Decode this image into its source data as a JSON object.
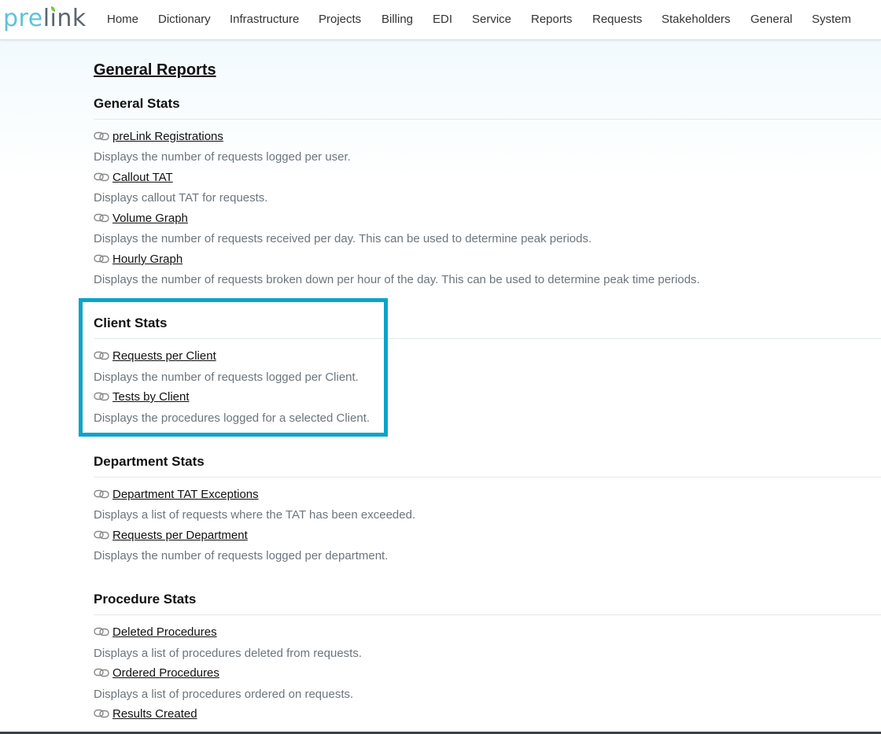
{
  "logo": {
    "part1": "pre",
    "part2": "link",
    "leaf_color": "#7ac943",
    "accent": "#5ec2d6"
  },
  "nav": {
    "items": [
      "Home",
      "Dictionary",
      "Infrastructure",
      "Projects",
      "Billing",
      "EDI",
      "Service",
      "Reports",
      "Requests",
      "Stakeholders",
      "General",
      "System"
    ]
  },
  "page": {
    "title": "General Reports"
  },
  "sections": [
    {
      "title": "General Stats",
      "reports": [
        {
          "label": "preLink Registrations",
          "description": "Displays the number of requests logged per user."
        },
        {
          "label": "Callout TAT",
          "description": "Displays callout TAT for requests."
        },
        {
          "label": "Volume Graph",
          "description": "Displays the number of requests received per day. This can be used to determine peak periods."
        },
        {
          "label": "Hourly Graph",
          "description": "Displays the number of requests broken down per hour of the day. This can be used to determine peak time periods."
        }
      ]
    },
    {
      "title": "Client Stats",
      "reports": [
        {
          "label": "Requests per Client",
          "description": "Displays the number of requests logged per Client."
        },
        {
          "label": "Tests by Client",
          "description": "Displays the procedures logged for a selected Client."
        }
      ]
    },
    {
      "title": "Department Stats",
      "reports": [
        {
          "label": "Department TAT Exceptions",
          "description": "Displays a list of requests where the TAT has been exceeded."
        },
        {
          "label": "Requests per Department",
          "description": "Displays the number of requests logged per department."
        }
      ]
    },
    {
      "title": "Procedure Stats",
      "reports": [
        {
          "label": "Deleted Procedures",
          "description": "Displays a list of procedures deleted from requests."
        },
        {
          "label": "Ordered Procedures",
          "description": "Displays a list of procedures ordered on requests."
        },
        {
          "label": "Results Created",
          "description": ""
        }
      ]
    }
  ],
  "colors": {
    "highlight": "#0aa4c9",
    "description_text": "#6c757d",
    "link_icon": "#888888"
  }
}
